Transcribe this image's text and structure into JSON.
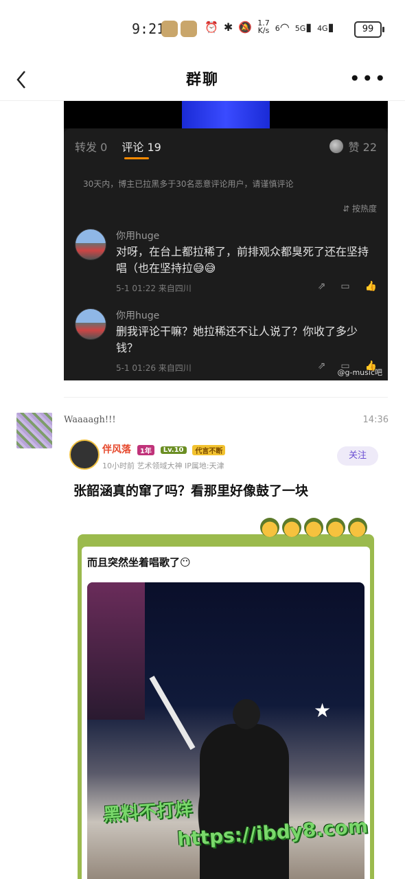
{
  "status_bar": {
    "time": "9:21",
    "net_speed_top": "1.7",
    "net_speed_bottom": "K/s",
    "signal1": "6",
    "sig_5g": "5G",
    "sig_4g": "4G",
    "battery": "99"
  },
  "nav": {
    "title": "群聊",
    "back_icon": "chevron-left-icon",
    "more_icon": "more-dots-icon"
  },
  "message1": {
    "tabs": {
      "repost": "转发 0",
      "comment": "评论 19"
    },
    "likes": "赞 22",
    "notice": "30天内，博主已拉黑多于30名恶意评论用户，请谨慎评论",
    "sort": "按热度",
    "comments": [
      {
        "name": "你用huge",
        "text": "对呀，在台上都拉稀了，前排观众都臭死了还在坚持唱（也在坚持拉😅😅",
        "meta": "5-1 01:22 来自四川"
      },
      {
        "name": "你用huge",
        "text": "删我评论干嘛？她拉稀还不让人说了？你收了多少钱？",
        "meta": "5-1 01:26 来自四川"
      }
    ],
    "watermark": "@g-music吧"
  },
  "message2": {
    "text": "Waaaagh!!!",
    "time": "14:36",
    "post": {
      "author": "伴风落",
      "badge_year": "1年",
      "badge_level": "Lv.10",
      "badge_star": "代言不断",
      "meta": "10小时前   艺术领域大神  IP属地:天津",
      "follow": "关注",
      "headline": "张韶涵真的窜了吗？看那里好像鼓了一块",
      "card_caption": "而且突然坐着唱歌了😶"
    }
  },
  "overlay_watermark": {
    "line1": "黑料不打烊",
    "line2": "https://ibdy8.com"
  }
}
